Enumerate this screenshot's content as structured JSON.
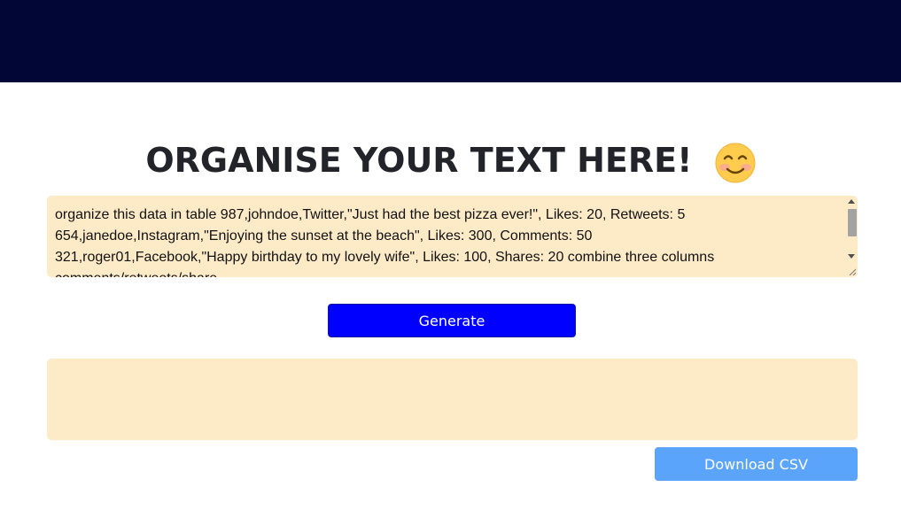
{
  "header": {
    "bg_color": "#020637"
  },
  "main": {
    "heading": "ORGANISE YOUR TEXT HERE!",
    "heading_emoji": "smiling-face-emoji",
    "input": {
      "value": "organize this data in table 987,johndoe,Twitter,\"Just had the best pizza ever!\", Likes: 20, Retweets: 5\n654,janedoe,Instagram,\"Enjoying the sunset at the beach\", Likes: 300, Comments: 50\n321,roger01,Facebook,\"Happy birthday to my lovely wife\", Likes: 100, Shares: 20 combine three columns\ncomments/retweets/share",
      "bg_color": "#fdebc8"
    },
    "generate_label": "Generate",
    "output": {
      "value": "",
      "bg_color": "#fdebc8"
    },
    "download_label": "Download CSV"
  },
  "colors": {
    "generate_button": "#0000fe",
    "download_button": "#5ba4fb"
  }
}
